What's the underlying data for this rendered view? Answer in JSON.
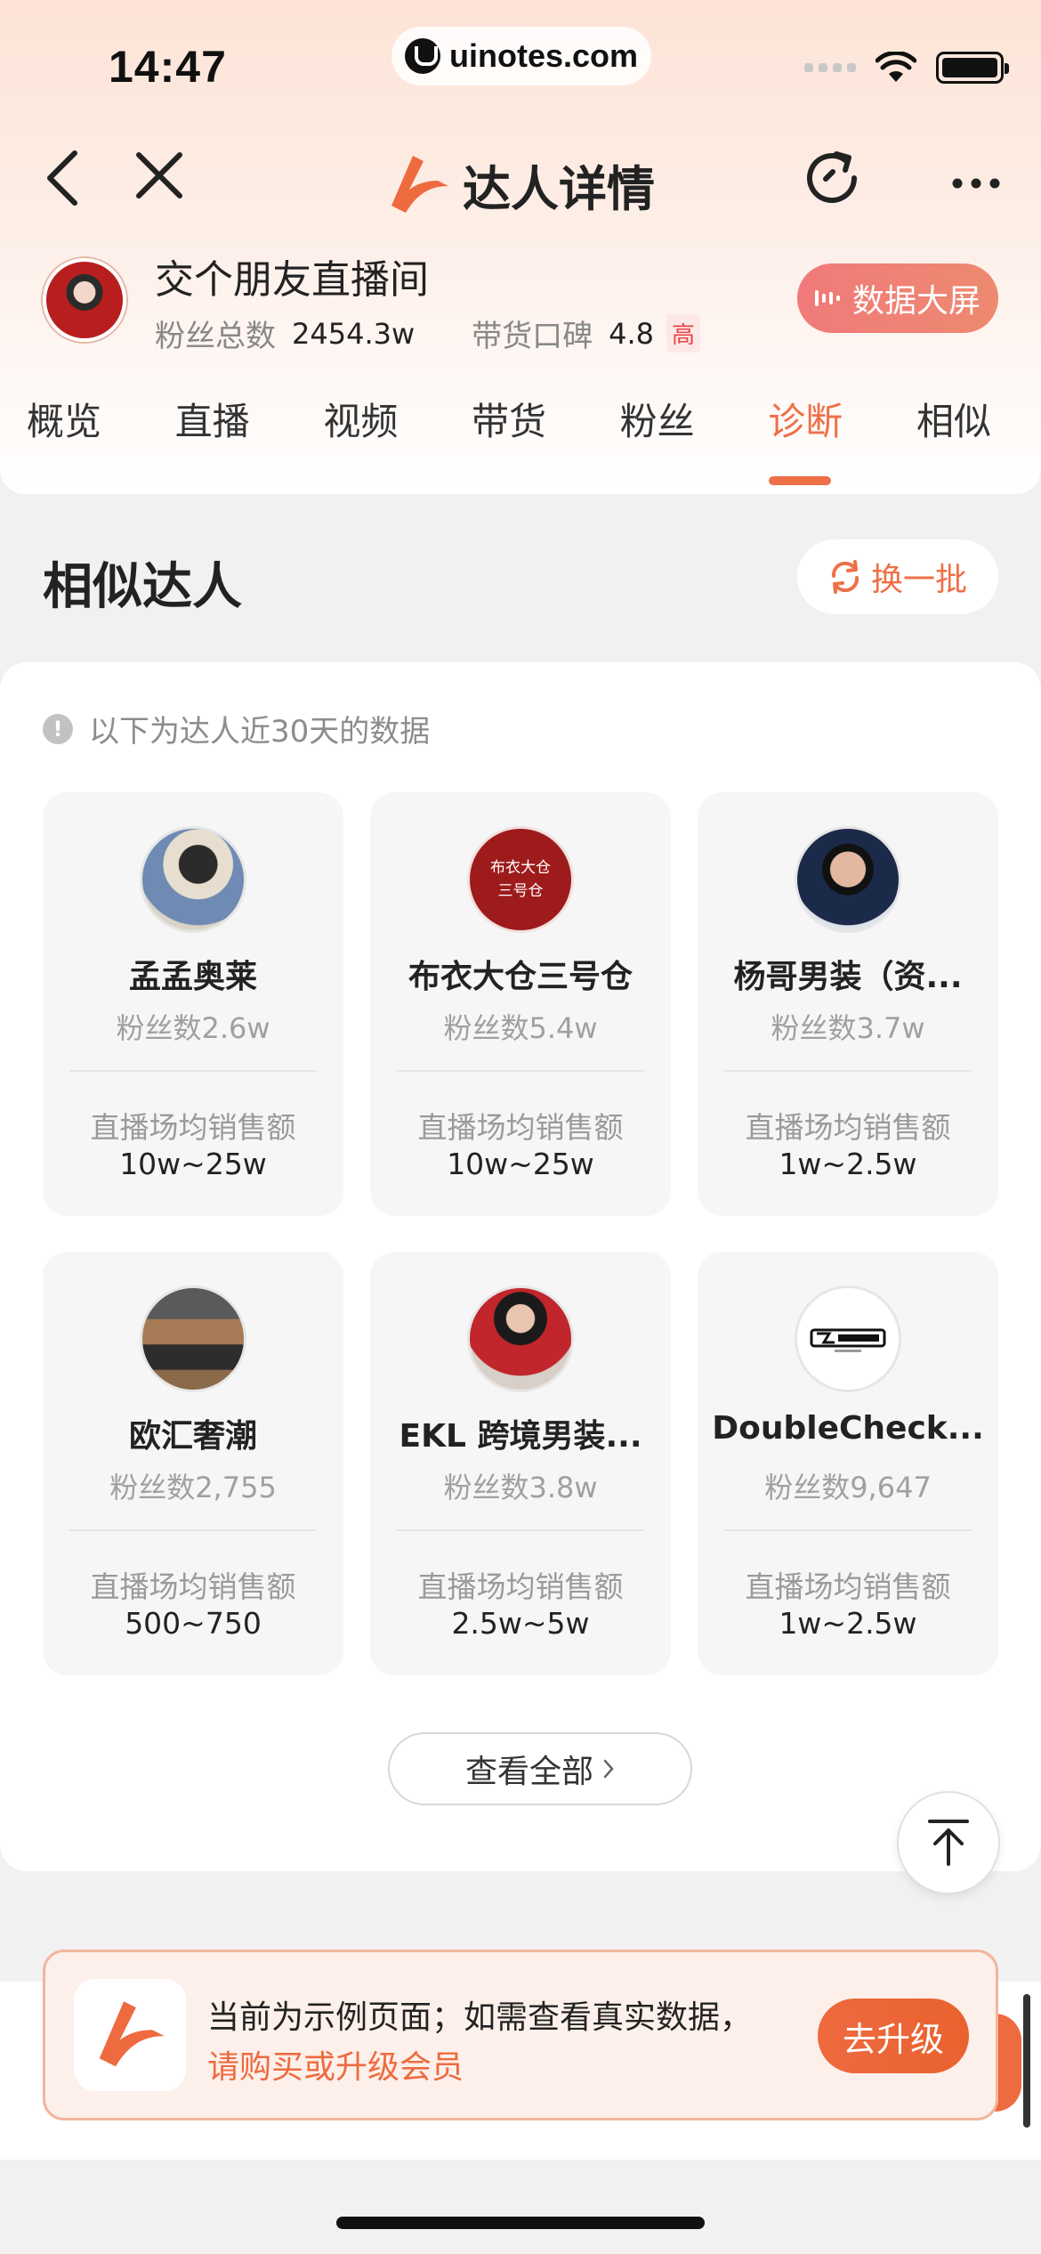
{
  "status_bar": {
    "time": "14:47",
    "url": "uinotes.com"
  },
  "nav": {
    "title": "达人详情"
  },
  "profile": {
    "name": "交个朋友直播间",
    "fans_label": "粉丝总数",
    "fans_value": "2454.3w",
    "reputation_label": "带货口碑",
    "reputation_value": "4.8",
    "reputation_tag": "高",
    "data_screen_label": "数据大屏"
  },
  "tabs": [
    {
      "label": "概览"
    },
    {
      "label": "直播"
    },
    {
      "label": "视频"
    },
    {
      "label": "带货"
    },
    {
      "label": "粉丝"
    },
    {
      "label": "诊断",
      "active": true
    },
    {
      "label": "相似"
    }
  ],
  "similar": {
    "title": "相似达人",
    "refresh_label": "换一批",
    "notice": "以下为达人近30天的数据",
    "metric_label": "直播场均销售额",
    "items": [
      {
        "name": "孟孟奥莱",
        "fans": "粉丝数2.6w",
        "metric": "10w~25w"
      },
      {
        "name": "布衣大仓三号仓",
        "fans": "粉丝数5.4w",
        "metric": "10w~25w",
        "avatar_text": "布衣大仓\n三号仓"
      },
      {
        "name": "杨哥男装（资...",
        "fans": "粉丝数3.7w",
        "metric": "1w~2.5w"
      },
      {
        "name": "欧汇奢潮",
        "fans": "粉丝数2,755",
        "metric": "500~750"
      },
      {
        "name": "EKL 跨境男装...",
        "fans": "粉丝数3.8w",
        "metric": "2.5w~5w"
      },
      {
        "name": "DoubleCheck...",
        "fans": "粉丝数9,647",
        "metric": "1w~2.5w"
      }
    ],
    "view_all": "查看全部"
  },
  "promo": {
    "line1": "当前为示例页面；如需查看真实数据，",
    "line2": "请购买或升级会员",
    "button": "去升级"
  },
  "colors": {
    "accent": "#ee7047",
    "brand_orange": "#ee6a3f"
  }
}
